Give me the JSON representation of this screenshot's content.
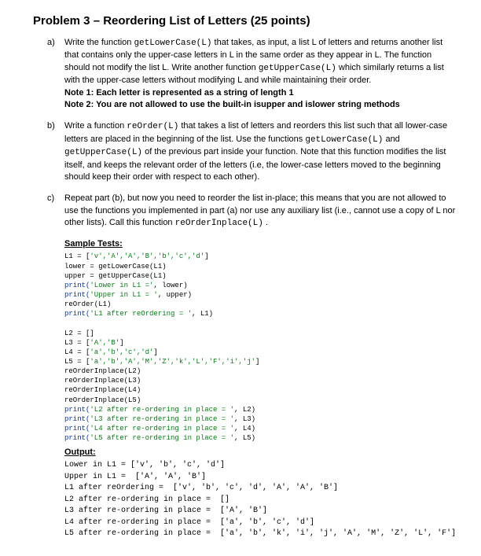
{
  "title": "Problem 3 – Reordering List of Letters (25 points)",
  "parts": {
    "a": {
      "label": "a)",
      "text_1": "Write the function ",
      "code_1": "getLowerCase(L)",
      "text_2": " that takes, as input, a list L of letters and returns another list that contains only the upper-case letters in L in the same order as they appear in L. The function should not modify the list L. Write another function ",
      "code_2": "getUpperCase(L)",
      "text_3": " which similarly returns a list with the upper-case letters without modifying L and while maintaining their order.",
      "note1": "Note 1: Each letter is represented as a string of length 1",
      "note2": "Note 2: You are not allowed to use the built-in isupper and islower string methods"
    },
    "b": {
      "label": "b)",
      "text_1": "Write a function ",
      "code_1": "reOrder(L)",
      "text_2": " that takes a list of letters and reorders this list such that all lower-case letters are placed in the beginning of the list. Use the functions ",
      "code_2": "getLowerCase(L)",
      "text_3": " and ",
      "code_3": "getUpperCase(L)",
      "text_4": " of the previous part inside your function. Note that this function modifies the list itself, and keeps the relevant order of the letters (i.e, the lower-case letters moved to the beginning should keep their order with respect to each other)."
    },
    "c": {
      "label": "c)",
      "text_1": "Repeat part (b), but now you need to reorder the list in-place; this means that you are not allowed to use the functions you implemented in part (a) nor use any auxiliary list (i.e., cannot use a copy of L nor other lists). Call this function ",
      "code_1": "reOrderInplace(L)",
      "text_2": " ."
    }
  },
  "sample_heading": "Sample Tests:",
  "output_heading": "Output:",
  "code": {
    "l01a": "L1 = [",
    "l01b": "'v','A','A','B','b','c','d'",
    "l01c": "]",
    "l02": "lower = getLowerCase(L1)",
    "l03": "upper = getUpperCase(L1)",
    "l04a": "print(",
    "l04b": "'Lower in L1 ='",
    "l04c": ", lower)",
    "l05a": "print(",
    "l05b": "'Upper in L1 = '",
    "l05c": ", upper)",
    "l06": "reOrder(L1)",
    "l07a": "print(",
    "l07b": "'L1 after reOrdering = '",
    "l07c": ", L1)",
    "blank": "",
    "l08": "L2 = []",
    "l09a": "L3 = [",
    "l09b": "'A','B'",
    "l09c": "]",
    "l10a": "L4 = [",
    "l10b": "'a','b','c','d'",
    "l10c": "]",
    "l11a": "L5 = [",
    "l11b": "'a','b','A','M','Z','k','L','F','i','j'",
    "l11c": "]",
    "l12": "reOrderInplace(L2)",
    "l13": "reOrderInplace(L3)",
    "l14": "reOrderInplace(L4)",
    "l15": "reOrderInplace(L5)",
    "l16a": "print(",
    "l16b": "'L2 after re-ordering in place = '",
    "l16c": ", L2)",
    "l17a": "print(",
    "l17b": "'L3 after re-ordering in place = '",
    "l17c": ", L3)",
    "l18a": "print(",
    "l18b": "'L4 after re-ordering in place = '",
    "l18c": ", L4)",
    "l19a": "print(",
    "l19b": "'L5 after re-ordering in place = '",
    "l19c": ", L5)"
  },
  "output": {
    "o1": "Lower in L1 = ['v', 'b', 'c', 'd']",
    "o2": "Upper in L1 =  ['A', 'A', 'B']",
    "o3": "L1 after reOrdering =  ['v', 'b', 'c', 'd', 'A', 'A', 'B']",
    "o4": "L2 after re-ordering in place =  []",
    "o5": "L3 after re-ordering in place =  ['A', 'B']",
    "o6": "L4 after re-ordering in place =  ['a', 'b', 'c', 'd']",
    "o7": "L5 after re-ordering in place =  ['a', 'b', 'k', 'i', 'j', 'A', 'M', 'Z', 'L', 'F']"
  }
}
